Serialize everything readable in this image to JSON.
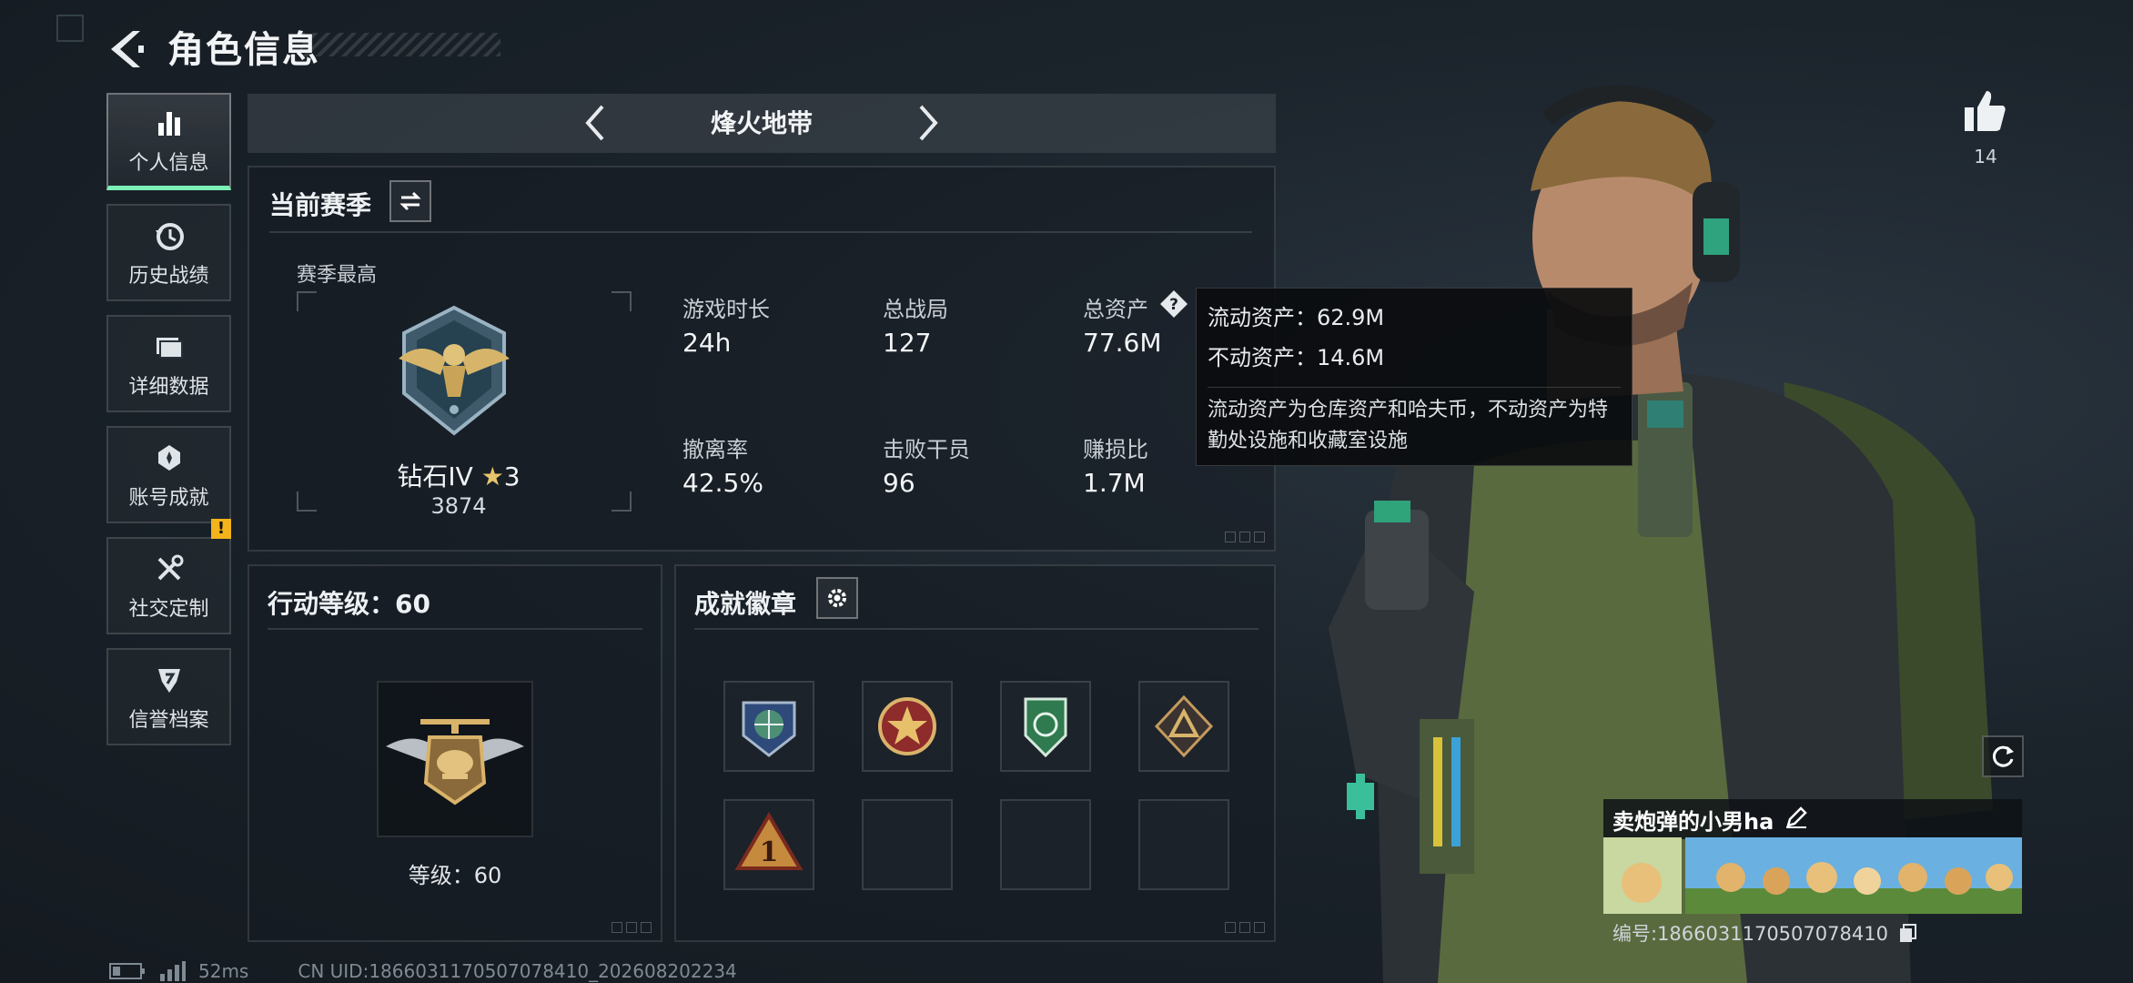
{
  "header": {
    "title": "角色信息"
  },
  "sidebar": {
    "items": [
      {
        "label": "个人信息",
        "icon": "bar-chart-icon",
        "active": true
      },
      {
        "label": "历史战绩",
        "icon": "history-clock-icon"
      },
      {
        "label": "详细数据",
        "icon": "folder-icon"
      },
      {
        "label": "账号成就",
        "icon": "achievement-icon"
      },
      {
        "label": "社交定制",
        "icon": "tools-icon",
        "badge": "!"
      },
      {
        "label": "信誉档案",
        "icon": "shield-icon"
      }
    ]
  },
  "mode": {
    "title": "烽火地带"
  },
  "season": {
    "title": "当前赛季",
    "best_label": "赛季最高",
    "rank": {
      "name": "钻石IV",
      "stars": "3",
      "score": "3874"
    },
    "stats": [
      {
        "label": "游戏时长",
        "value": "24h"
      },
      {
        "label": "总战局",
        "value": "127"
      },
      {
        "label": "总资产",
        "value": "77.6M"
      },
      {
        "label": "撤离率",
        "value": "42.5%"
      },
      {
        "label": "击败干员",
        "value": "96"
      },
      {
        "label": "赚损比",
        "value": "1.7M"
      }
    ]
  },
  "tooltip": {
    "liquid": "流动资产：62.9M",
    "fixed": "不动资产：14.6M",
    "desc": "流动资产为仓库资产和哈夫币，不动资产为特勤处设施和收藏室设施"
  },
  "level": {
    "title": "行动等级：60",
    "caption": "等级：60"
  },
  "badges": {
    "title": "成就徽章"
  },
  "likes": {
    "count": "14"
  },
  "player": {
    "name": "卖炮弹的小男ha",
    "uid": "编号:1866031170507078410"
  },
  "footer": {
    "ping": "52ms",
    "uid": "CN UID:1866031170507078410_202608202234"
  },
  "colors": {
    "accent": "#7cf0b6",
    "warning": "#f2b31b",
    "background": "#1b232b"
  }
}
